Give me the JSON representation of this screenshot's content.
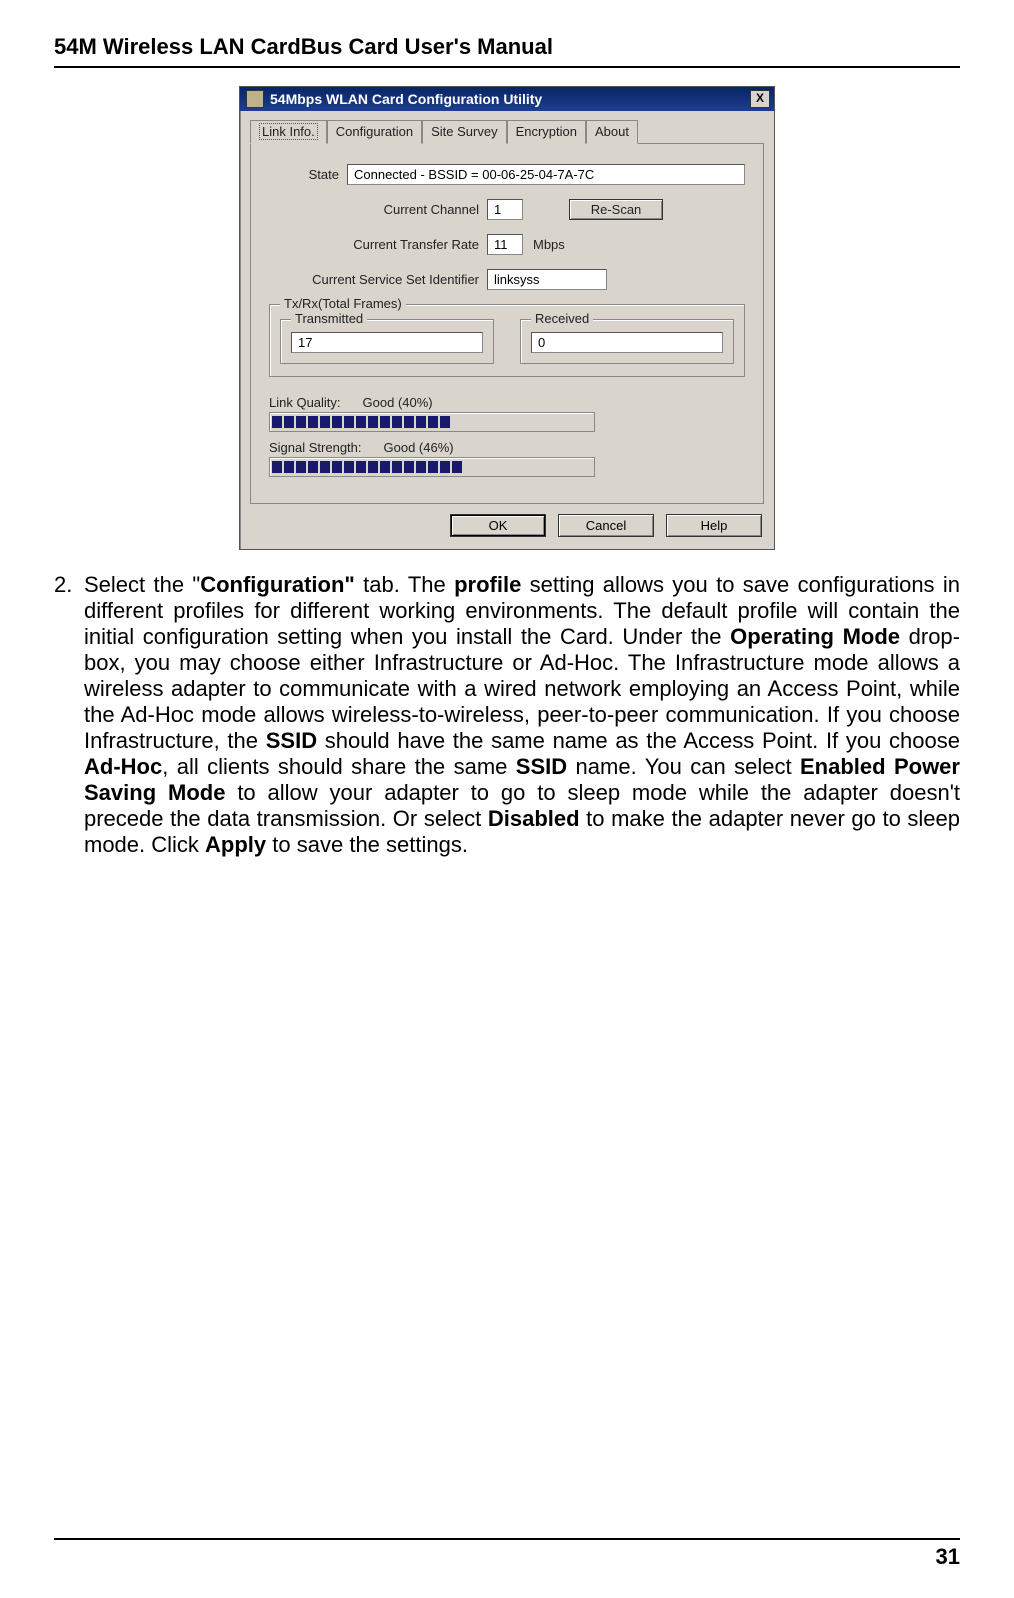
{
  "header": {
    "title": "54M Wireless LAN CardBus Card User's Manual"
  },
  "screenshot": {
    "window_title": "54Mbps WLAN Card Configuration Utility",
    "close_glyph": "X",
    "tabs": {
      "link_info": "Link Info.",
      "configuration": "Configuration",
      "site_survey": "Site Survey",
      "encryption": "Encryption",
      "about": "About"
    },
    "state_label": "State",
    "state_value": "Connected - BSSID = 00-06-25-04-7A-7C",
    "current_channel_label": "Current Channel",
    "current_channel_value": "1",
    "rescan_label": "Re-Scan",
    "rate_label": "Current Transfer Rate",
    "rate_value": "11",
    "rate_unit": "Mbps",
    "ssid_label": "Current Service Set Identifier",
    "ssid_value": "linksyss",
    "txrx_group": "Tx/Rx(Total Frames)",
    "transmitted_label": "Transmitted",
    "transmitted_value": "17",
    "received_label": "Received",
    "received_value": "0",
    "link_quality_label": "Link Quality:",
    "link_quality_value": "Good (40%)",
    "signal_strength_label": "Signal Strength:",
    "signal_strength_value": "Good (46%)",
    "buttons": {
      "ok": "OK",
      "cancel": "Cancel",
      "help": "Help"
    }
  },
  "list": {
    "number": "2."
  },
  "para": {
    "p1a": "Select the \"",
    "p1b": "Configuration\"",
    "p1c": " tab. The ",
    "p1d": "profile",
    "p1e": " setting allows you to save configurations in different profiles for different working environments. The default profile will contain the initial configuration setting when you install the Card. Under the ",
    "p1f": "Operating Mode",
    "p1g": " drop-box, you may choose either Infrastructure or Ad-Hoc. The Infrastructure mode allows a wireless adapter to communicate with a wired network employing an Access Point, while the Ad-Hoc mode allows wireless-to-wireless, peer-to-peer communication. If you choose Infrastructure, the ",
    "p1h": "SSID",
    "p1i": " should have the same name as the Access Point. If you choose ",
    "p1j": "Ad-Hoc",
    "p1k": ", all clients should share the same ",
    "p1l": "SSID",
    "p1m": " name. You can select ",
    "p1n": "Enabled Power Saving Mode",
    "p1o": " to allow your adapter to go to sleep mode while the adapter doesn't precede the data transmission. Or select ",
    "p1p": "Disabled",
    "p1q": " to make the adapter never go to sleep mode. Click ",
    "p1r": "Apply",
    "p1s": " to save the settings."
  },
  "footer": {
    "page": "31"
  }
}
